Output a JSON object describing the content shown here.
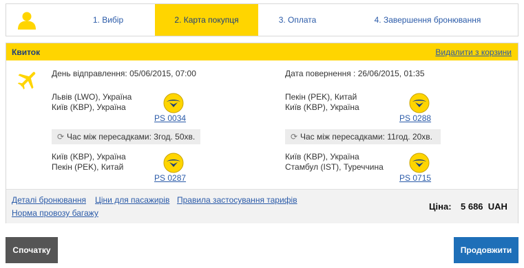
{
  "steps": [
    {
      "label": "1. Вибір",
      "active": false
    },
    {
      "label": "2. Карта покупця",
      "active": true
    },
    {
      "label": "3. Оплата",
      "active": false
    },
    {
      "label": "4. Завершення бронювання",
      "active": false
    }
  ],
  "ticket": {
    "title": "Квиток",
    "remove_label": "Видалити з корзини",
    "departure": {
      "label": "День відправлення:",
      "datetime": "05/06/2015, 07:00",
      "segment1": {
        "from": "Львів (LWO), Україна",
        "to": "Київ (KBP), Україна",
        "flight": "PS 0034"
      },
      "transfer": {
        "label": "Час між пересадками:",
        "value": "3год. 50хв."
      },
      "segment2": {
        "from": "Київ (KBP), Україна",
        "to": "Пекін (PEK), Китай",
        "flight": "PS 0287"
      }
    },
    "return": {
      "label": "Дата повернення :",
      "datetime": "26/06/2015, 01:35",
      "segment1": {
        "from": "Пекін (PEK), Китай",
        "to": "Київ (KBP), Україна",
        "flight": "PS 0288"
      },
      "transfer": {
        "label": "Час між пересадками:",
        "value": "11год. 20хв."
      },
      "segment2": {
        "from": "Київ (KBP), Україна",
        "to": "Стамбул (IST), Туреччина",
        "flight": "PS 0715"
      }
    },
    "footer": {
      "links": [
        "Деталі бронювання",
        "Ціни для пасажирів",
        "Правила застосування тарифів",
        "Норма провозу багажу"
      ],
      "price_label": "Ціна:",
      "price_value": "5 686  UAH"
    }
  },
  "buttons": {
    "back": "Спочатку",
    "next": "Продовжити"
  },
  "colors": {
    "accent_yellow": "#ffd500",
    "link_blue": "#2a5aa8",
    "next_button": "#1e6fb8",
    "back_button": "#555555"
  },
  "icons": {
    "avatar": "user-icon",
    "plane": "airplane-icon",
    "airline": "airline-logo-icon",
    "transfer": "cycle-icon"
  }
}
